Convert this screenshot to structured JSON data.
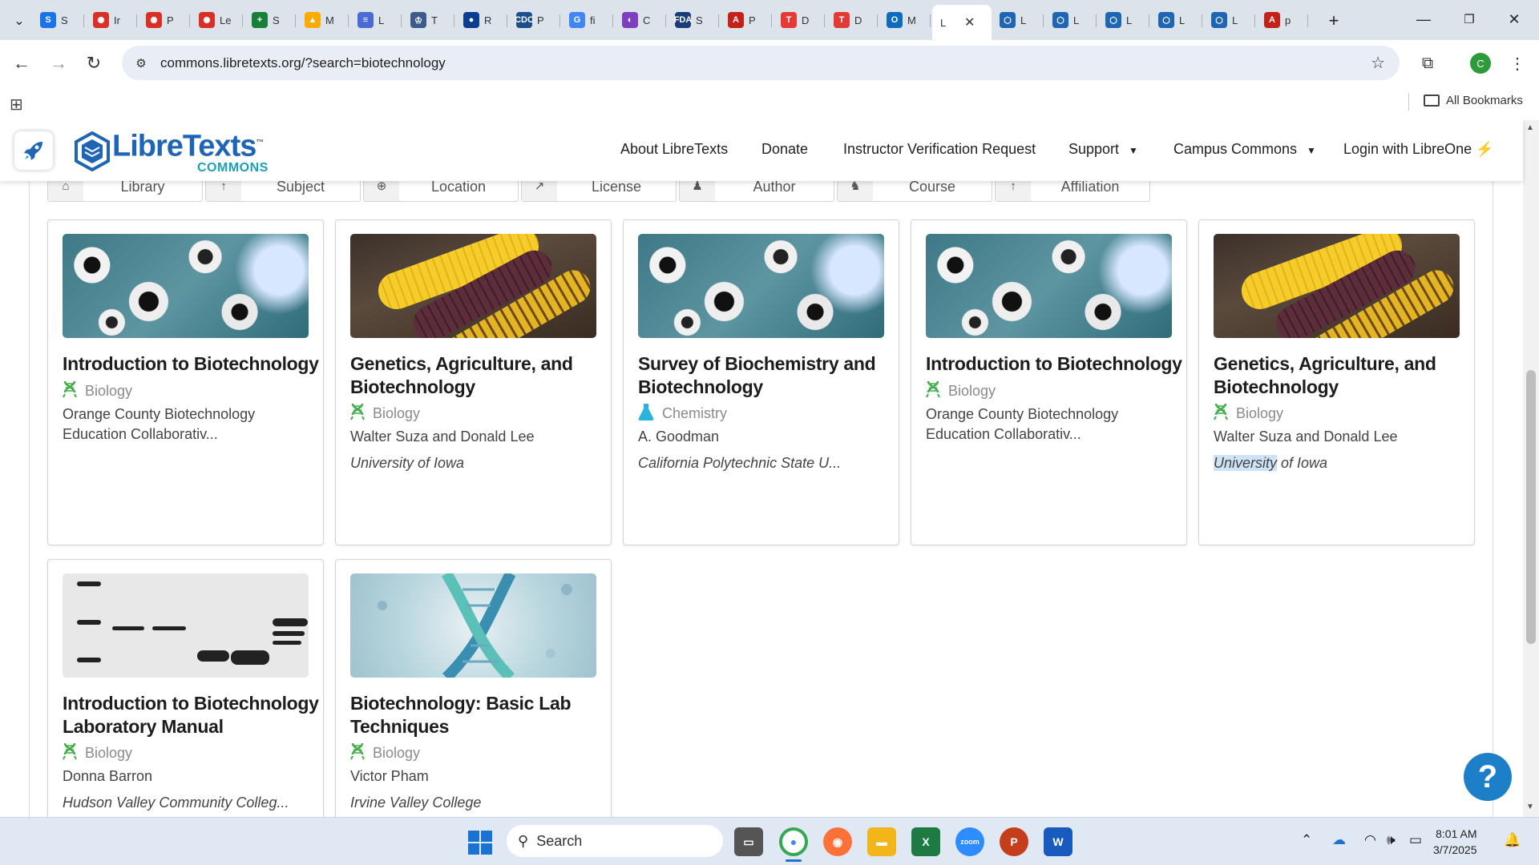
{
  "browser": {
    "tabs": [
      {
        "label": "S",
        "favicon": "S",
        "color": "#1a73e8"
      },
      {
        "label": "Ir",
        "favicon": "✺",
        "color": "#d93025"
      },
      {
        "label": "P",
        "favicon": "✺",
        "color": "#d93025"
      },
      {
        "label": "Le",
        "favicon": "✺",
        "color": "#d93025"
      },
      {
        "label": "S",
        "favicon": "+",
        "color": "#188038"
      },
      {
        "label": "M",
        "favicon": "▲",
        "color": "#f9ab00"
      },
      {
        "label": "L",
        "favicon": "≡",
        "color": "#4a6bd4"
      },
      {
        "label": "T",
        "favicon": "♔",
        "color": "#3c5a8a"
      },
      {
        "label": "R",
        "favicon": "●",
        "color": "#0b3d91"
      },
      {
        "label": "P",
        "favicon": "CDC",
        "color": "#1a4f8b"
      },
      {
        "label": "fi",
        "favicon": "G",
        "color": "#4285f4"
      },
      {
        "label": "C",
        "favicon": "◐",
        "color": "#7b3fbf"
      },
      {
        "label": "S",
        "favicon": "FDA",
        "color": "#1a3d7a"
      },
      {
        "label": "P",
        "favicon": "A",
        "color": "#c5211a"
      },
      {
        "label": "D",
        "favicon": "T",
        "color": "#e53935"
      },
      {
        "label": "D",
        "favicon": "T",
        "color": "#e53935"
      },
      {
        "label": "M",
        "favicon": "O",
        "color": "#0f6cbd"
      },
      {
        "label": "L",
        "favicon": "",
        "color": "#ffffff",
        "active": true
      },
      {
        "label": "L",
        "favicon": "⬡",
        "color": "#1e65b6"
      },
      {
        "label": "L",
        "favicon": "⬡",
        "color": "#1e65b6"
      },
      {
        "label": "L",
        "favicon": "⬡",
        "color": "#1e65b6"
      },
      {
        "label": "L",
        "favicon": "⬡",
        "color": "#1e65b6"
      },
      {
        "label": "L",
        "favicon": "⬡",
        "color": "#1e65b6"
      },
      {
        "label": "p",
        "favicon": "A",
        "color": "#c5211a"
      }
    ],
    "url": "commons.libretexts.org/?search=biotechnology",
    "profile_initial": "C",
    "all_bookmarks": "All Bookmarks"
  },
  "site": {
    "brand_main": "LibreTexts",
    "brand_tm": "™",
    "brand_sub": "COMMONS",
    "nav": {
      "about": "About LibreTexts",
      "donate": "Donate",
      "verification": "Instructor Verification Request",
      "support": "Support",
      "campus": "Campus Commons",
      "login": "Login with LibreOne"
    },
    "filters": [
      "Library",
      "Subject",
      "Location",
      "License",
      "Author",
      "Course",
      "Affiliation"
    ]
  },
  "results": [
    {
      "title": "Introduction to Biotechnology",
      "subject": "Biology",
      "author": "Orange County Biotechnology Education Collaborativ...",
      "affiliation": "",
      "thumb": "mold"
    },
    {
      "title": "Genetics, Agriculture, and Biotechnology",
      "subject": "Biology",
      "author": "Walter Suza and Donald Lee",
      "affiliation": "University of Iowa",
      "thumb": "corn"
    },
    {
      "title": "Survey of Biochemistry and Biotechnology",
      "subject": "Chemistry",
      "author": "A. Goodman",
      "affiliation": "California Polytechnic State U...",
      "thumb": "mold"
    },
    {
      "title": "Introduction to Biotechnology",
      "subject": "Biology",
      "author": "Orange County Biotechnology Education Collaborativ...",
      "affiliation": "",
      "thumb": "mold"
    },
    {
      "title": "Genetics, Agriculture, and Biotechnology",
      "subject": "Biology",
      "author": "Walter Suza and Donald Lee",
      "affiliation_highlight": "University",
      "affiliation_rest": " of Iowa",
      "thumb": "corn"
    },
    {
      "title": "Introduction to Biotechnology Laboratory Manual",
      "subject": "Biology",
      "author": "Donna Barron",
      "affiliation": "Hudson Valley Community Colleg...",
      "thumb": "gel"
    },
    {
      "title": "Biotechnology: Basic Lab Techniques",
      "subject": "Biology",
      "author": "Victor Pham",
      "affiliation": "Irvine Valley College",
      "thumb": "dna"
    }
  ],
  "help_label": "?",
  "taskbar": {
    "search_placeholder": "Search",
    "time": "8:01 AM",
    "date": "3/7/2025"
  },
  "colors": {
    "accent": "#1e65b6",
    "brand_sub": "#1ba1b6",
    "biology_icon": "#3fae49",
    "chemistry_icon": "#2bb3e0"
  }
}
